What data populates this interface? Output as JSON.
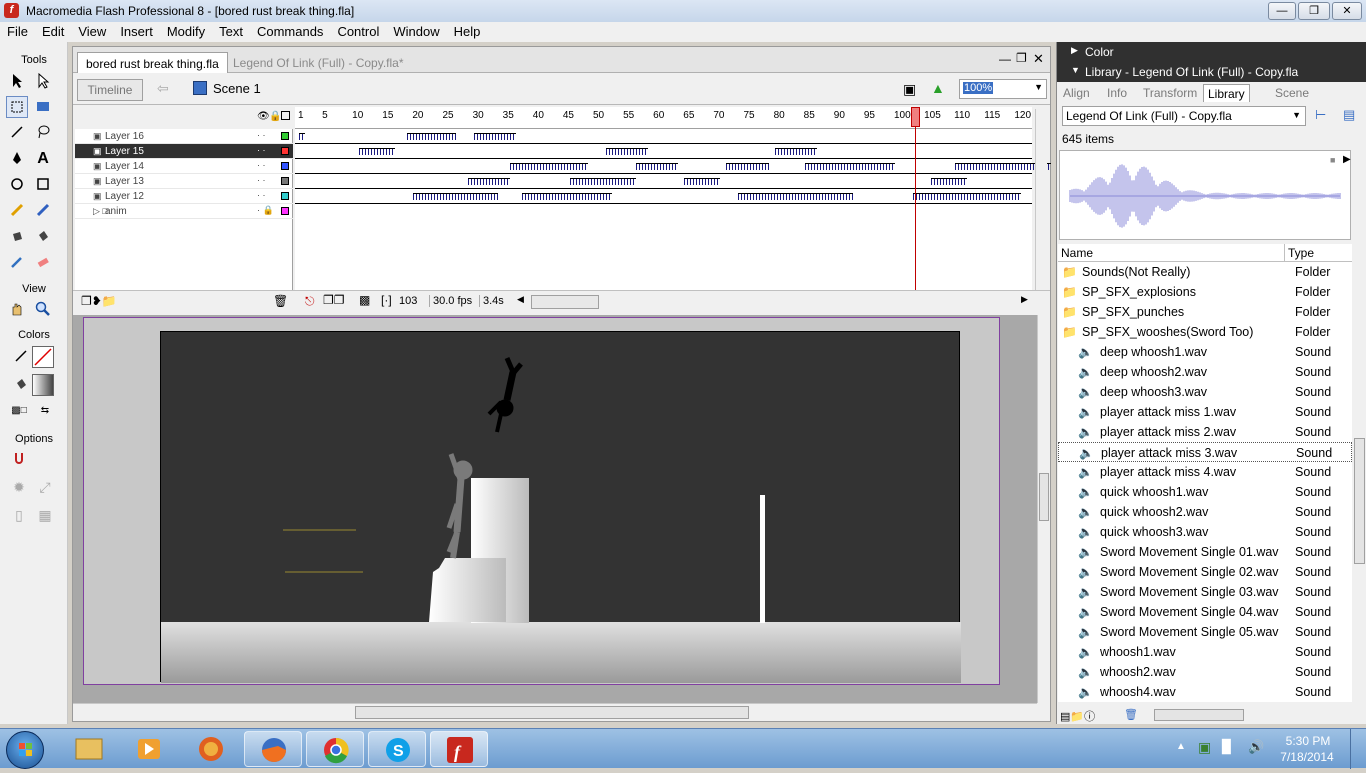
{
  "window": {
    "title": "Macromedia Flash Professional 8 - [bored rust break thing.fla]",
    "buttons": [
      "minimize",
      "restore",
      "close"
    ]
  },
  "menu": [
    "File",
    "Edit",
    "View",
    "Insert",
    "Modify",
    "Text",
    "Commands",
    "Control",
    "Window",
    "Help"
  ],
  "tools": {
    "title": "Tools",
    "view_label": "View",
    "colors_label": "Colors",
    "options_label": "Options"
  },
  "document": {
    "tabs": [
      "bored rust break thing.fla",
      "Legend Of Link (Full) - Copy.fla*"
    ],
    "timeline_button": "Timeline",
    "scene": "Scene 1",
    "zoom": "100%"
  },
  "timeline": {
    "ruler": [
      "1",
      "5",
      "10",
      "15",
      "20",
      "25",
      "30",
      "35",
      "40",
      "45",
      "50",
      "55",
      "60",
      "65",
      "70",
      "75",
      "80",
      "85",
      "90",
      "95",
      "100",
      "105",
      "110",
      "115",
      "120"
    ],
    "layers": [
      {
        "name": "Layer 16",
        "color": "#33cc33",
        "selected": false
      },
      {
        "name": "Layer 15",
        "color": "#ff3333",
        "selected": true
      },
      {
        "name": "Layer 14",
        "color": "#3355ff",
        "selected": false
      },
      {
        "name": "Layer 13",
        "color": "#777777",
        "selected": false
      },
      {
        "name": "Layer 12",
        "color": "#33cccc",
        "selected": false
      },
      {
        "name": "anim",
        "color": "#ff33ff",
        "selected": false
      }
    ],
    "current_frame": "103",
    "fps": "30.0 fps",
    "time": "3.4s"
  },
  "panels": {
    "color_header": "Color",
    "library_header": "Library - Legend Of Link (Full) - Copy.fla",
    "tabs": [
      "Align",
      "Info",
      "Transform",
      "Library",
      "Scene"
    ],
    "active_tab": "Library",
    "library_select": "Legend Of Link (Full) - Copy.fla",
    "item_count": "645 items",
    "col_name": "Name",
    "col_type": "Type",
    "items": [
      {
        "name": "Sounds(Not Really)",
        "type": "Folder",
        "icon": "folder-icon"
      },
      {
        "name": "SP_SFX_explosions",
        "type": "Folder",
        "icon": "folder-icon"
      },
      {
        "name": "SP_SFX_punches",
        "type": "Folder",
        "icon": "folder-icon"
      },
      {
        "name": "SP_SFX_wooshes(Sword Too)",
        "type": "Folder",
        "icon": "folder-open-icon"
      },
      {
        "name": "deep whoosh1.wav",
        "type": "Sound",
        "icon": "sound-icon"
      },
      {
        "name": "deep whoosh2.wav",
        "type": "Sound",
        "icon": "sound-icon"
      },
      {
        "name": "deep whoosh3.wav",
        "type": "Sound",
        "icon": "sound-icon"
      },
      {
        "name": "player attack miss 1.wav",
        "type": "Sound",
        "icon": "sound-icon"
      },
      {
        "name": "player attack miss 2.wav",
        "type": "Sound",
        "icon": "sound-icon"
      },
      {
        "name": "player attack miss 3.wav",
        "type": "Sound",
        "icon": "sound-icon"
      },
      {
        "name": "player attack miss 4.wav",
        "type": "Sound",
        "icon": "sound-icon"
      },
      {
        "name": "quick whoosh1.wav",
        "type": "Sound",
        "icon": "sound-icon"
      },
      {
        "name": "quick whoosh2.wav",
        "type": "Sound",
        "icon": "sound-icon"
      },
      {
        "name": "quick whoosh3.wav",
        "type": "Sound",
        "icon": "sound-icon"
      },
      {
        "name": "Sword Movement Single 01.wav",
        "type": "Sound",
        "icon": "sound-icon"
      },
      {
        "name": "Sword Movement Single 02.wav",
        "type": "Sound",
        "icon": "sound-icon"
      },
      {
        "name": "Sword Movement Single 03.wav",
        "type": "Sound",
        "icon": "sound-icon"
      },
      {
        "name": "Sword Movement Single 04.wav",
        "type": "Sound",
        "icon": "sound-icon"
      },
      {
        "name": "Sword Movement Single 05.wav",
        "type": "Sound",
        "icon": "sound-icon"
      },
      {
        "name": "whoosh1.wav",
        "type": "Sound",
        "icon": "sound-icon"
      },
      {
        "name": "whoosh2.wav",
        "type": "Sound",
        "icon": "sound-icon"
      },
      {
        "name": "whoosh4.wav",
        "type": "Sound",
        "icon": "sound-icon"
      }
    ],
    "selected_item": "player attack miss 3.wav"
  },
  "taskbar": {
    "apps": [
      "start-orb",
      "explorer-icon",
      "media-player-icon",
      "firefox-alt-icon",
      "firefox-icon",
      "chrome-icon",
      "skype-icon",
      "flash-icon"
    ],
    "time": "5:30 PM",
    "date": "7/18/2014"
  }
}
